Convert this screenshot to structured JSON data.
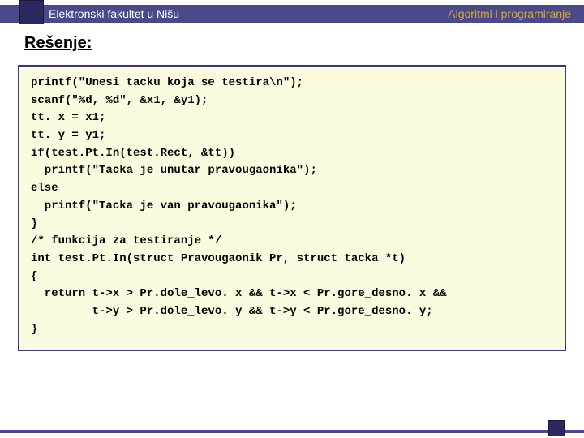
{
  "header": {
    "left": "Elektronski fakultet u Nišu",
    "right": "Algoritmi i programiranje"
  },
  "section_title": "Rešenje:",
  "code_lines": [
    "printf(\"Unesi tacku koja se testira\\n\");",
    "scanf(\"%d, %d\", &x1, &y1);",
    "tt. x = x1;",
    "tt. y = y1;",
    "if(test.Pt.In(test.Rect, &tt))",
    "  printf(\"Tacka je unutar pravougaonika\");",
    "else",
    "  printf(\"Tacka je van pravougaonika\");",
    "}",
    "/* funkcija za testiranje */",
    "int test.Pt.In(struct Pravougaonik Pr, struct tacka *t)",
    "{",
    "  return t->x > Pr.dole_levo. x && t->x < Pr.gore_desno. x &&",
    "         t->y > Pr.dole_levo. y && t->y < Pr.gore_desno. y;",
    "}"
  ]
}
